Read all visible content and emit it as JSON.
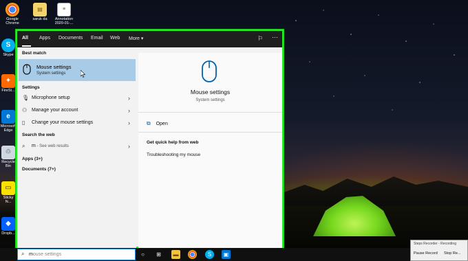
{
  "desktop": {
    "icons": [
      {
        "label": "Google Chrome"
      },
      {
        "label": "saruk da"
      },
      {
        "label": "Annotation 2020-01-..."
      },
      {
        "label": "Skype"
      },
      {
        "label": "FireSt..."
      },
      {
        "label": "Microsoft Edge"
      },
      {
        "label": "Recycle Bin"
      },
      {
        "label": "Sticky N..."
      },
      {
        "label": "Dropb..."
      }
    ]
  },
  "start_menu": {
    "tabs": [
      {
        "label": "All",
        "active": true
      },
      {
        "label": "Apps"
      },
      {
        "label": "Documents"
      },
      {
        "label": "Email"
      },
      {
        "label": "Web"
      },
      {
        "label": "More ▾"
      }
    ],
    "best_match_heading": "Best match",
    "best_match": {
      "title": "Mouse settings",
      "subtitle": "System settings",
      "icon": "mouse-icon"
    },
    "settings_heading": "Settings",
    "settings_items": [
      {
        "label": "Microphone setup",
        "icon": "microphone-icon"
      },
      {
        "label": "Manage your account",
        "icon": "person-icon"
      },
      {
        "label": "Change your mouse settings",
        "icon": "mouse-icon"
      }
    ],
    "web_heading": "Search the web",
    "web_item": {
      "query": "m",
      "suffix": " - See web results",
      "icon": "search-icon"
    },
    "apps_heading": "Apps (3+)",
    "documents_heading": "Documents (7+)",
    "preview": {
      "title": "Mouse settings",
      "subtitle": "System settings",
      "open_label": "Open",
      "web_help_heading": "Get quick help from web",
      "web_help_link": "Troubleshooting my mouse"
    }
  },
  "taskbar": {
    "search_typed": "m",
    "search_placeholder": "ouse settings",
    "icons": [
      "cortana-icon",
      "task-view-icon",
      "file-explorer-icon",
      "chrome-icon",
      "skype-icon",
      "store-icon"
    ]
  },
  "steps_recorder": {
    "title": "Steps Recorder - Recording",
    "pause_label": "Pause Record",
    "stop_label": "Stop Re..."
  },
  "colors": {
    "highlight": "#a8cce8",
    "accent": "#0063b1",
    "frame": "#22ee22"
  }
}
